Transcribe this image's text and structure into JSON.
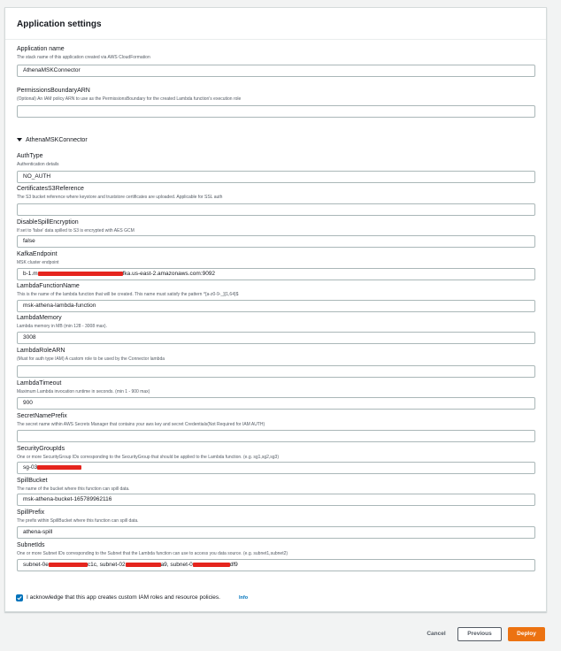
{
  "panel": {
    "title": "Application settings"
  },
  "app_name": {
    "label": "Application name",
    "description": "The stack name of this application created via AWS CloudFormation",
    "value": "AthenaMSKConnector"
  },
  "permissions_boundary": {
    "label": "PermissionsBoundaryARN",
    "description": "(Optional) An IAM policy ARN to use as the PermissionsBoundary for the created Lambda function's execution role",
    "value": ""
  },
  "section": {
    "title": "AthenaMSKConnector"
  },
  "fields": {
    "auth_type": {
      "label": "AuthType",
      "description": "Authentication details",
      "value": "NO_AUTH"
    },
    "certificates": {
      "label": "CertificatesS3Reference",
      "description": "The S3 bucket reference where keystore and truststore certificates are uploaded. Applicable for SSL auth",
      "value": ""
    },
    "disable_spill": {
      "label": "DisableSpillEncryption",
      "description": "If set to 'false' data spilled to S3 is encrypted with AES GCM",
      "value": "false"
    },
    "kafka_endpoint": {
      "label": "KafkaEndpoint",
      "description": "MSK cluster endpoint",
      "value_prefix": "b-1.m",
      "value_suffix": "fka.us-east-2.amazonaws.com:9092"
    },
    "lambda_function_name": {
      "label": "LambdaFunctionName",
      "description": "This is the name of the lambda function that will be created. This name must satisfy the pattern ^[a-z0-9-_]{1,64}$",
      "value": "msk-athena-lambda-function"
    },
    "lambda_memory": {
      "label": "LambdaMemory",
      "description": "Lambda memory in MB (min 128 - 3008 max).",
      "value": "3008"
    },
    "lambda_role_arn": {
      "label": "LambdaRoleARN",
      "description": "(Must for auth type IAM) A custom role to be used by the Connector lambda",
      "value": ""
    },
    "lambda_timeout": {
      "label": "LambdaTimeout",
      "description": "Maximum Lambda invocation runtime in seconds. (min 1 - 900 max)",
      "value": "900"
    },
    "secret_name_prefix": {
      "label": "SecretNamePrefix",
      "description": "The secret name within AWS Secrets Manager that contains your aws key and secret Credentials(Not Required for IAM AUTH)",
      "value": ""
    },
    "security_group_ids": {
      "label": "SecurityGroupIds",
      "description": "One or more SecurityGroup IDs corresponding to the SecurityGroup that should be applied to the Lambda function. (e.g. sg1,sg2,sg3)",
      "value_prefix": "sg-03"
    },
    "spill_bucket": {
      "label": "SpillBucket",
      "description": "The name of the bucket where this function can spill data.",
      "value": "msk-athena-bucket-165789962116"
    },
    "spill_prefix": {
      "label": "SpillPrefix",
      "description": "The prefix within SpillBucket where this function can spill data.",
      "value": "athena-spill"
    },
    "subnet_ids": {
      "label": "SubnetIds",
      "description": "One or more Subnet IDs corresponding to the Subnet that the Lambda function can use to access you data source. (e.g. subnet1,subnet2)",
      "value_part1": "subnet-0e",
      "value_part2": "c1c, subnet-02",
      "value_part3": "a9, subnet-0",
      "value_part4": "df9"
    }
  },
  "acknowledge": {
    "text": "I acknowledge that this app creates custom IAM roles and resource policies.",
    "info": "Info",
    "checked": true
  },
  "footer": {
    "cancel": "Cancel",
    "previous": "Previous",
    "deploy": "Deploy"
  },
  "colors": {
    "accent": "#ec7211",
    "link": "#0073bb",
    "redaction": "#e5251e"
  }
}
